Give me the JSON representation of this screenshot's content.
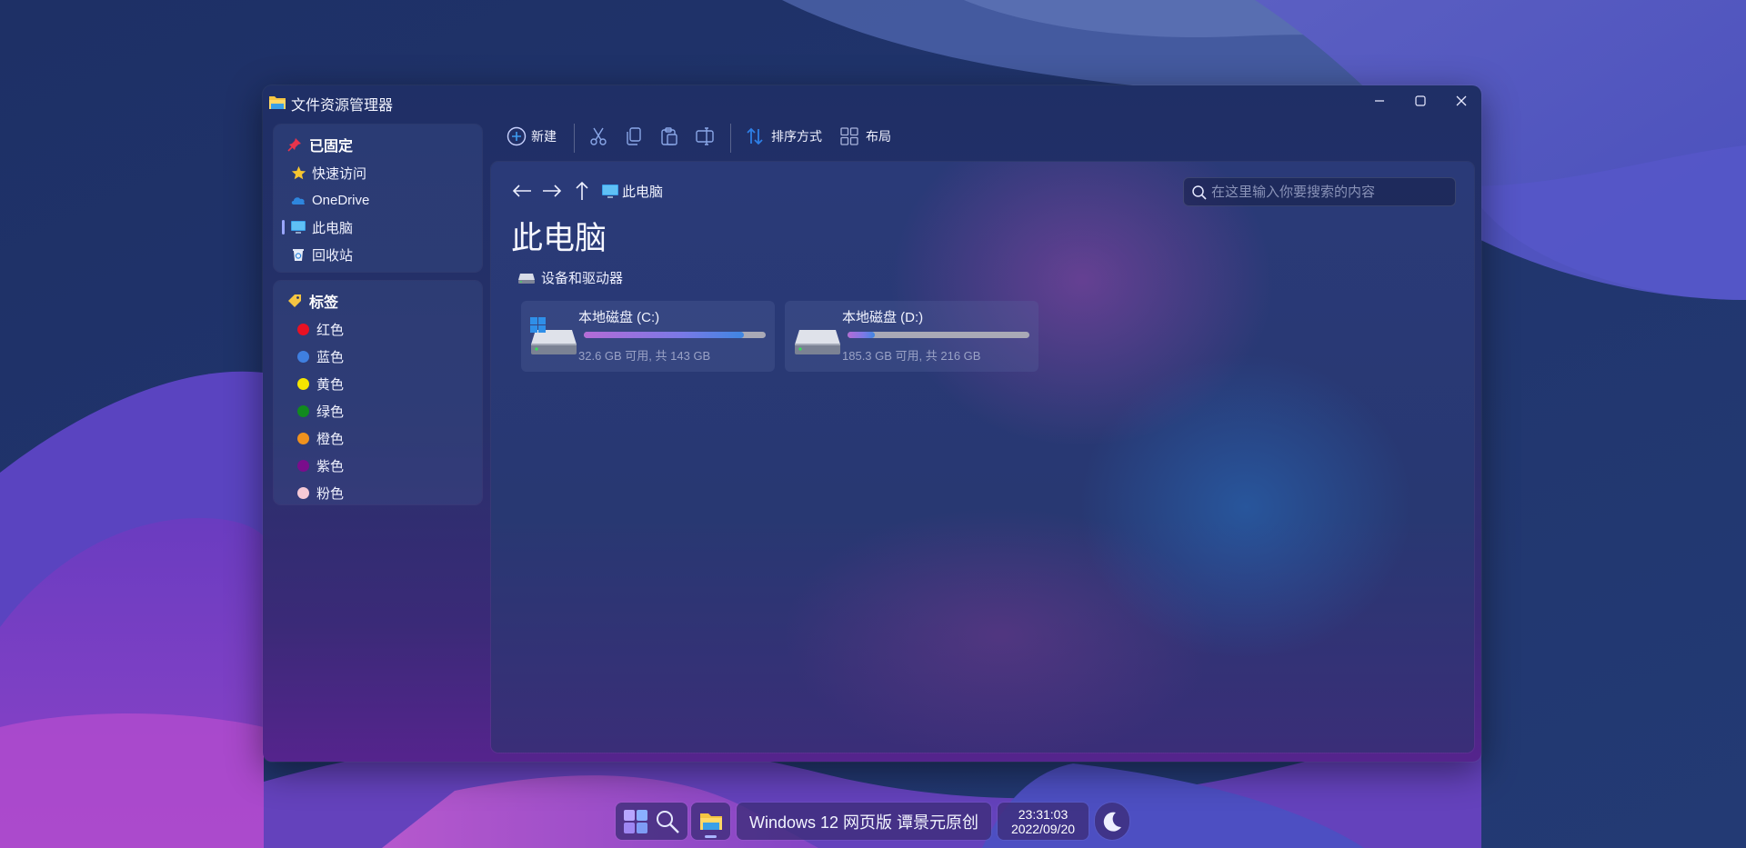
{
  "window": {
    "title": "文件资源管理器",
    "controls": {
      "minimize": "minimize",
      "maximize": "maximize",
      "close": "close"
    }
  },
  "sidebar": {
    "pinned": {
      "heading": "已固定",
      "items": [
        {
          "label": "快速访问",
          "icon": "star-icon"
        },
        {
          "label": "OneDrive",
          "icon": "cloud-icon"
        },
        {
          "label": "此电脑",
          "icon": "monitor-icon",
          "active": true
        },
        {
          "label": "回收站",
          "icon": "recycle-bin-icon"
        }
      ]
    },
    "tags": {
      "heading": "标签",
      "items": [
        {
          "label": "红色",
          "color": "#e81123"
        },
        {
          "label": "蓝色",
          "color": "#3f7fe0"
        },
        {
          "label": "黄色",
          "color": "#f5e500"
        },
        {
          "label": "绿色",
          "color": "#118a1f"
        },
        {
          "label": "橙色",
          "color": "#f0921e"
        },
        {
          "label": "紫色",
          "color": "#7a0d8c"
        },
        {
          "label": "粉色",
          "color": "#f6c9d6"
        }
      ]
    }
  },
  "toolbar": {
    "new_label": "新建",
    "sort_label": "排序方式",
    "layout_label": "布局"
  },
  "content": {
    "breadcrumb": "此电脑",
    "search_placeholder": "在这里输入你要搜索的内容",
    "page_title": "此电脑",
    "section_title": "设备和驱动器",
    "drives": [
      {
        "name": "本地磁盘 (C:)",
        "size_text": "32.6 GB 可用, 共 143 GB",
        "used_fraction": 0.88,
        "system": true
      },
      {
        "name": "本地磁盘 (D:)",
        "size_text": "185.3 GB 可用, 共 216 GB",
        "used_fraction": 0.15,
        "system": false
      }
    ]
  },
  "taskbar": {
    "app_title": "Windows 12 网页版 谭景元原创",
    "time": "23:31:03",
    "date": "2022/09/20"
  },
  "colors": {
    "accent": "#7b79e6",
    "close_hover": "#e81123",
    "sort_icon": "#2e7fe6"
  }
}
